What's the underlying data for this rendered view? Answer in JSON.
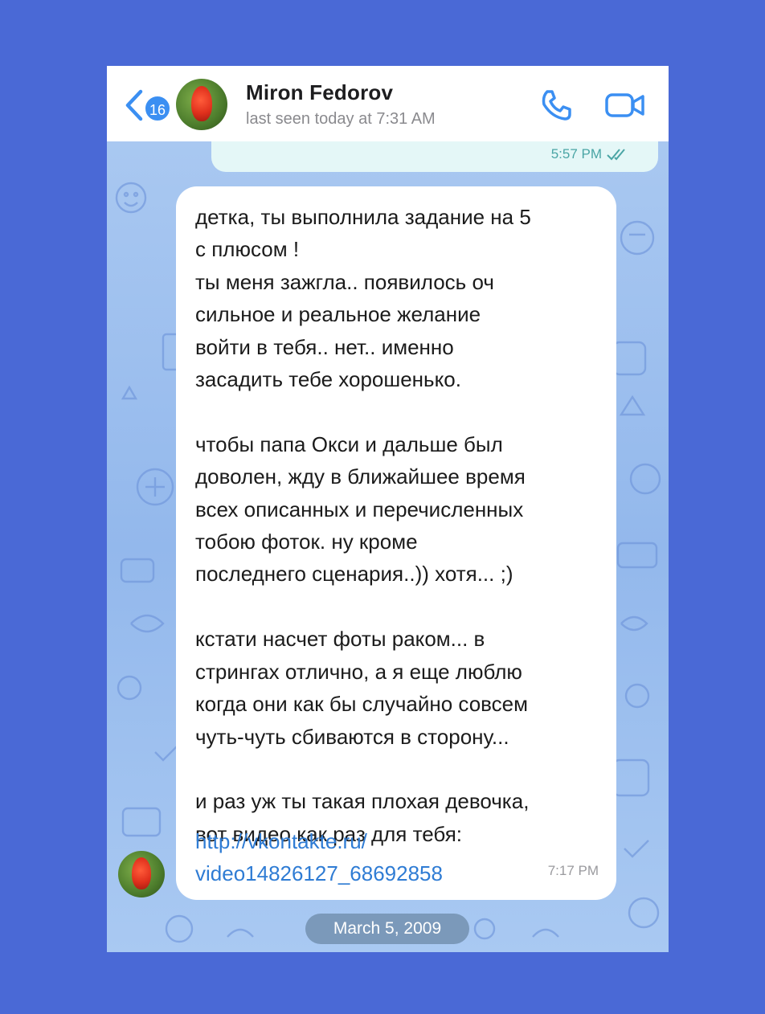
{
  "header": {
    "back_badge": "16",
    "contact_name": "Miron Fedorov",
    "last_seen": "last seen today at 7:31 AM",
    "icons": [
      "chevron-left-icon",
      "phone-icon",
      "video-camera-icon"
    ]
  },
  "messages": {
    "previous": {
      "time": "5:57 PM",
      "status_icon": "double-check-icon"
    },
    "current": {
      "text": "детка, ты выполнила задание на 5\nс плюсом !\nты меня зажгла.. появилось оч\nсильное и реальное желание\nвойти в тебя.. нет.. именно\nзасадить тебе хорошенько.\n\nчтобы папа Окси и дальше был\nдоволен, жду в ближайшее время\nвсех описанных и перечисленных\nтобою фоток. ну кроме\nпоследнего сценария..)) хотя... ;)\n\nкстати насчет фоты раком... в\nстрингах отлично, а я еще люблю\nкогда они как бы случайно совсем\nчуть-чуть сбиваются в сторону...\n\nи раз уж ты такая плохая девочка,\nвот видео как раз для тебя:",
      "link": "http://vkontakte.ru/\nvideo14826127_68692858",
      "time": "7:17 PM"
    }
  },
  "date_separator": "March 5, 2009",
  "colors": {
    "page_background": "#4a69d6",
    "chat_background": "#9ec0ee",
    "accent": "#3b8ff2",
    "link": "#2f7cd4",
    "outgoing_bubble": "#e4f7f7"
  }
}
